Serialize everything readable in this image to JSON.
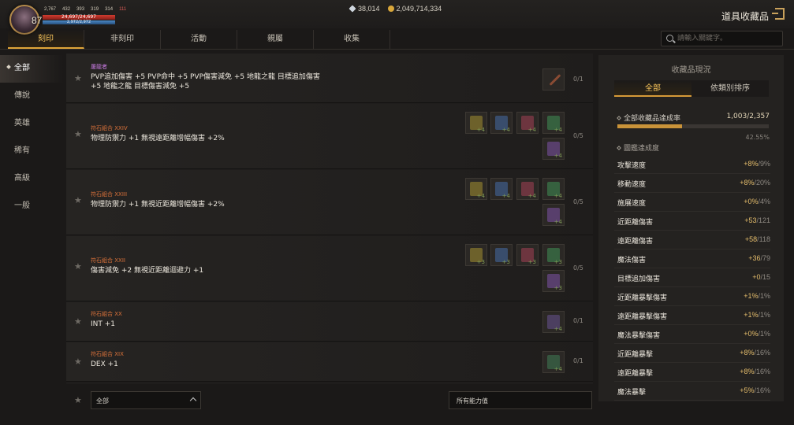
{
  "player": {
    "level": "87",
    "stats": [
      "2,767",
      "432",
      "393",
      "319",
      "314",
      "111"
    ],
    "hp_text": "24,697/24,697",
    "hp_fraction": 1.0,
    "mp_text": "2,972/2,972",
    "mp_fraction": 1.0
  },
  "currency": {
    "diamonds": "38,014",
    "gold": "2,049,714,334"
  },
  "app_title": "道具收藏品",
  "tabs": [
    "刻印",
    "非刻印",
    "活動",
    "親屬",
    "收集"
  ],
  "search": {
    "placeholder": "請輸入關鍵字。"
  },
  "sidebar": [
    "全部",
    "傳說",
    "英雄",
    "稀有",
    "高級",
    "一般"
  ],
  "rows": [
    {
      "category": "屠龍者",
      "cat_color": "purple",
      "desc": "PVP追加傷害 +5 PVP命中 +5 PVP傷害減免 +5 地龍之龍 目標追加傷害 +5 地龍之龍 目標傷害減免 +5",
      "count": "0/1",
      "slots": []
    },
    {
      "category": "符石組合 XXIV",
      "cat_color": "orange",
      "desc": "物理防禦力 +1 無視遠距離增幅傷害 +2%",
      "count": "0/5",
      "slots": [
        "+4",
        "+4",
        "+4",
        "+4",
        "+4"
      ]
    },
    {
      "category": "符石組合 XXIII",
      "cat_color": "orange",
      "desc": "物理防禦力 +1 無視近距離增幅傷害 +2%",
      "count": "0/5",
      "slots": [
        "+4",
        "+4",
        "+4",
        "+4",
        "+4"
      ]
    },
    {
      "category": "符石組合 XXII",
      "cat_color": "orange",
      "desc": "傷害減免 +2 無視近距離迴避力 +1",
      "count": "0/5",
      "slots": [
        "+3",
        "+3",
        "+3",
        "+3",
        "+3"
      ]
    },
    {
      "category": "符石組合 XX",
      "cat_color": "orange",
      "desc": "INT +1",
      "count": "0/1",
      "slots": [
        "+4"
      ]
    },
    {
      "category": "符石組合 XIX",
      "cat_color": "orange",
      "desc": "DEX +1",
      "count": "0/1",
      "slots": [
        "+4"
      ]
    }
  ],
  "filters": {
    "grade": "全部",
    "ability": "所有能力值"
  },
  "right_panel": {
    "title": "收藏品現況",
    "tabs": [
      "全部",
      "依類別排序"
    ],
    "rate_label": "全部收藏品達成率",
    "rate_value": "1,003/2,357",
    "rate_percent": "42.55%",
    "rate_fraction": 0.4255,
    "codex_label": "圖鑑達成度",
    "stats": [
      {
        "name": "攻擊速度",
        "cur": "+8%",
        "max": "/9%"
      },
      {
        "name": "移動速度",
        "cur": "+8%",
        "max": "/20%"
      },
      {
        "name": "施展速度",
        "cur": "+0%",
        "max": "/4%"
      },
      {
        "name": "近距離傷害",
        "cur": "+53",
        "max": "/121"
      },
      {
        "name": "遠距離傷害",
        "cur": "+58",
        "max": "/118"
      },
      {
        "name": "魔法傷害",
        "cur": "+36",
        "max": "/79"
      },
      {
        "name": "目標追加傷害",
        "cur": "+0",
        "max": "/15"
      },
      {
        "name": "近距離暴擊傷害",
        "cur": "+1%",
        "max": "/1%"
      },
      {
        "name": "遠距離暴擊傷害",
        "cur": "+1%",
        "max": "/1%"
      },
      {
        "name": "魔法暴擊傷害",
        "cur": "+0%",
        "max": "/1%"
      },
      {
        "name": "近距離暴擊",
        "cur": "+8%",
        "max": "/16%"
      },
      {
        "name": "遠距離暴擊",
        "cur": "+8%",
        "max": "/16%"
      },
      {
        "name": "魔法暴擊",
        "cur": "+5%",
        "max": "/16%"
      }
    ]
  },
  "colors": {
    "accent": "#f6c35a",
    "purple": "#c77ae0",
    "orange": "#d8713a"
  }
}
